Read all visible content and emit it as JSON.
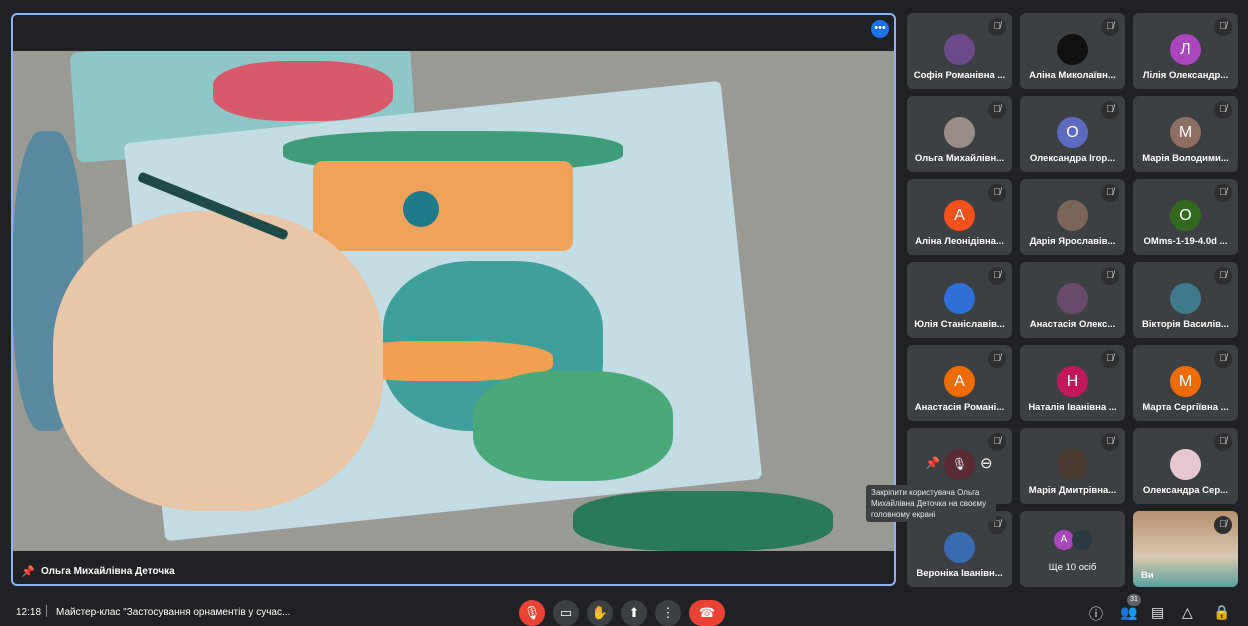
{
  "main": {
    "speaker": "Ольга Михайлівна Деточка",
    "more_icon": "more-horiz-icon"
  },
  "tiles": [
    {
      "name": "Софія Романівна ...",
      "avatar": "",
      "color": "#6b4a8a"
    },
    {
      "name": "Аліна Миколаївн...",
      "avatar": "",
      "color": "#111111"
    },
    {
      "name": "Лілія Олександр...",
      "avatar": "Л",
      "color": "#ab47bc"
    },
    {
      "name": "Ольга Михайлівн...",
      "avatar": "",
      "color": "#9a8c88"
    },
    {
      "name": "Олександра Ігор...",
      "avatar": "О",
      "color": "#5c6bc0"
    },
    {
      "name": "Марія Володими...",
      "avatar": "М",
      "color": "#8d6e63"
    },
    {
      "name": "Аліна Леонідівна...",
      "avatar": "А",
      "color": "#f4511e"
    },
    {
      "name": "Дарія Ярославів...",
      "avatar": "",
      "color": "#7a6558"
    },
    {
      "name": "OMms-1-19-4.0d ...",
      "avatar": "О",
      "color": "#33691e"
    },
    {
      "name": "Юлія Станіславів...",
      "avatar": "",
      "color": "#2f6fd6"
    },
    {
      "name": "Анастасія Олекс...",
      "avatar": "",
      "color": "#6a4a6a"
    },
    {
      "name": "Вікторія Василів...",
      "avatar": "",
      "color": "#3f7a8a"
    },
    {
      "name": "Анастасія Романі...",
      "avatar": "А",
      "color": "#ef6c00"
    },
    {
      "name": "Наталія Іванівна ...",
      "avatar": "Н",
      "color": "#c2185b"
    },
    {
      "name": "Марта Сергіївна ...",
      "avatar": "М",
      "color": "#ef6c00"
    },
    {
      "name": "",
      "avatar": "",
      "color": ""
    },
    {
      "name": "Марія Дмитрівна...",
      "avatar": "",
      "color": "#4a3a30"
    },
    {
      "name": "Олександра Сер...",
      "avatar": "",
      "color": "#e8c8d0"
    },
    {
      "name": "Вероніка Іванівн...",
      "avatar": "",
      "color": "#3a6ab0"
    },
    {
      "name": "Ще 10 осіб",
      "avatar": "А",
      "color": "#ab47bc"
    },
    {
      "name": "Ви",
      "avatar": "",
      "color": ""
    }
  ],
  "tooltip": "Закріпити користувача Ольга Михайлівна Деточка на своєму головному екрані",
  "bottom": {
    "time": "12:18",
    "meeting_title": "Майстер-клас \"Застосування орнаментів у сучас...",
    "participants_count": "31"
  }
}
